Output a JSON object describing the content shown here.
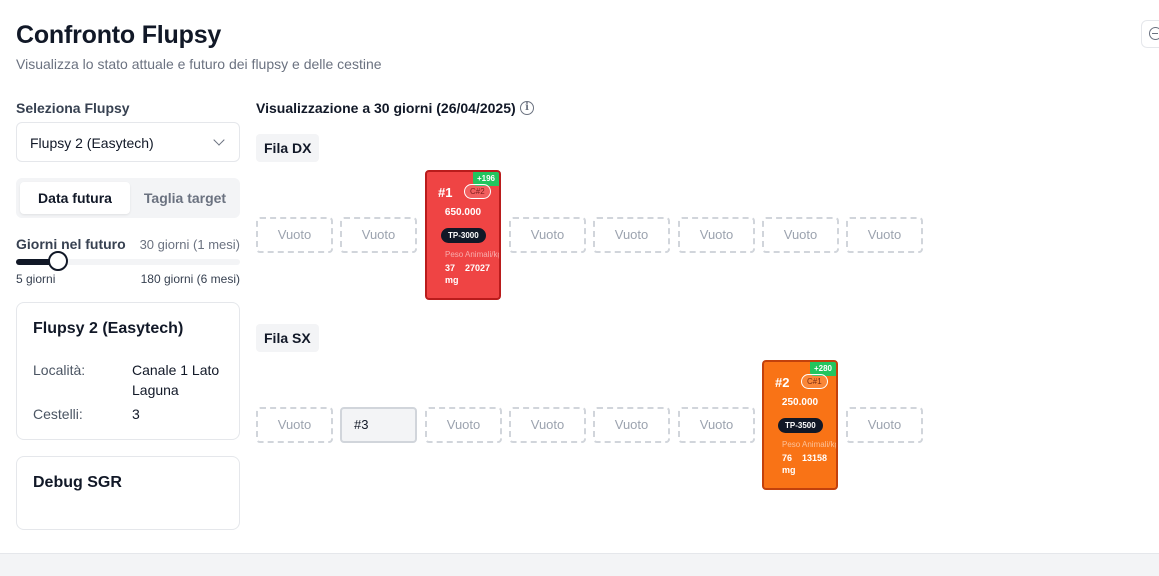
{
  "header": {
    "title": "Confronto Flupsy",
    "subtitle": "Visualizza lo stato attuale e futuro dei flupsy e delle cestine"
  },
  "sidebar": {
    "select_label": "Seleziona Flupsy",
    "select_value": "Flupsy 2 (Easytech)",
    "tabs": [
      {
        "label": "Data futura",
        "active": true
      },
      {
        "label": "Taglia target",
        "active": false
      }
    ],
    "days": {
      "label": "Giorni nel futuro",
      "value_text": "30 giorni (1 mesi)",
      "value": 30,
      "min": 5,
      "max": 180,
      "min_label": "5 giorni",
      "max_label": "180 giorni (6 mesi)"
    },
    "info_card": {
      "title": "Flupsy 2 (Easytech)",
      "location_label": "Località:",
      "location_value": "Canale 1 Lato Laguna",
      "baskets_label": "Cestelli:",
      "baskets_value": "3"
    },
    "debug_card": {
      "title": "Debug SGR"
    }
  },
  "main": {
    "title": "Visualizzazione a 30 giorni (26/04/2025)",
    "info_icon": "info-icon",
    "rows": [
      {
        "label": "Fila DX",
        "slots": [
          {
            "type": "empty",
            "label": "Vuoto"
          },
          {
            "type": "empty",
            "label": "Vuoto"
          },
          {
            "type": "basket",
            "color": "#ef4444",
            "number": "#1",
            "cycle": "C#2",
            "growth": "+196",
            "count": "650.000",
            "size": "TP-3000",
            "weight_label": "Peso",
            "weight_value": "37",
            "weight_unit": "mg",
            "animals_label": "Animali/kg",
            "animals_value": "27027"
          },
          {
            "type": "empty",
            "label": "Vuoto"
          },
          {
            "type": "empty",
            "label": "Vuoto"
          },
          {
            "type": "empty",
            "label": "Vuoto"
          },
          {
            "type": "empty",
            "label": "Vuoto"
          },
          {
            "type": "empty",
            "label": "Vuoto"
          }
        ]
      },
      {
        "label": "Fila SX",
        "slots": [
          {
            "type": "empty",
            "label": "Vuoto"
          },
          {
            "type": "plain",
            "label": "#3"
          },
          {
            "type": "empty",
            "label": "Vuoto"
          },
          {
            "type": "empty",
            "label": "Vuoto"
          },
          {
            "type": "empty",
            "label": "Vuoto"
          },
          {
            "type": "empty",
            "label": "Vuoto"
          },
          {
            "type": "basket",
            "color": "#f97316",
            "number": "#2",
            "cycle": "C#1",
            "growth": "+280",
            "count": "250.000",
            "size": "TP-3500",
            "weight_label": "Peso",
            "weight_value": "76",
            "weight_unit": "mg",
            "animals_label": "Animali/kg",
            "animals_value": "13158"
          },
          {
            "type": "empty",
            "label": "Vuoto"
          }
        ]
      }
    ]
  }
}
